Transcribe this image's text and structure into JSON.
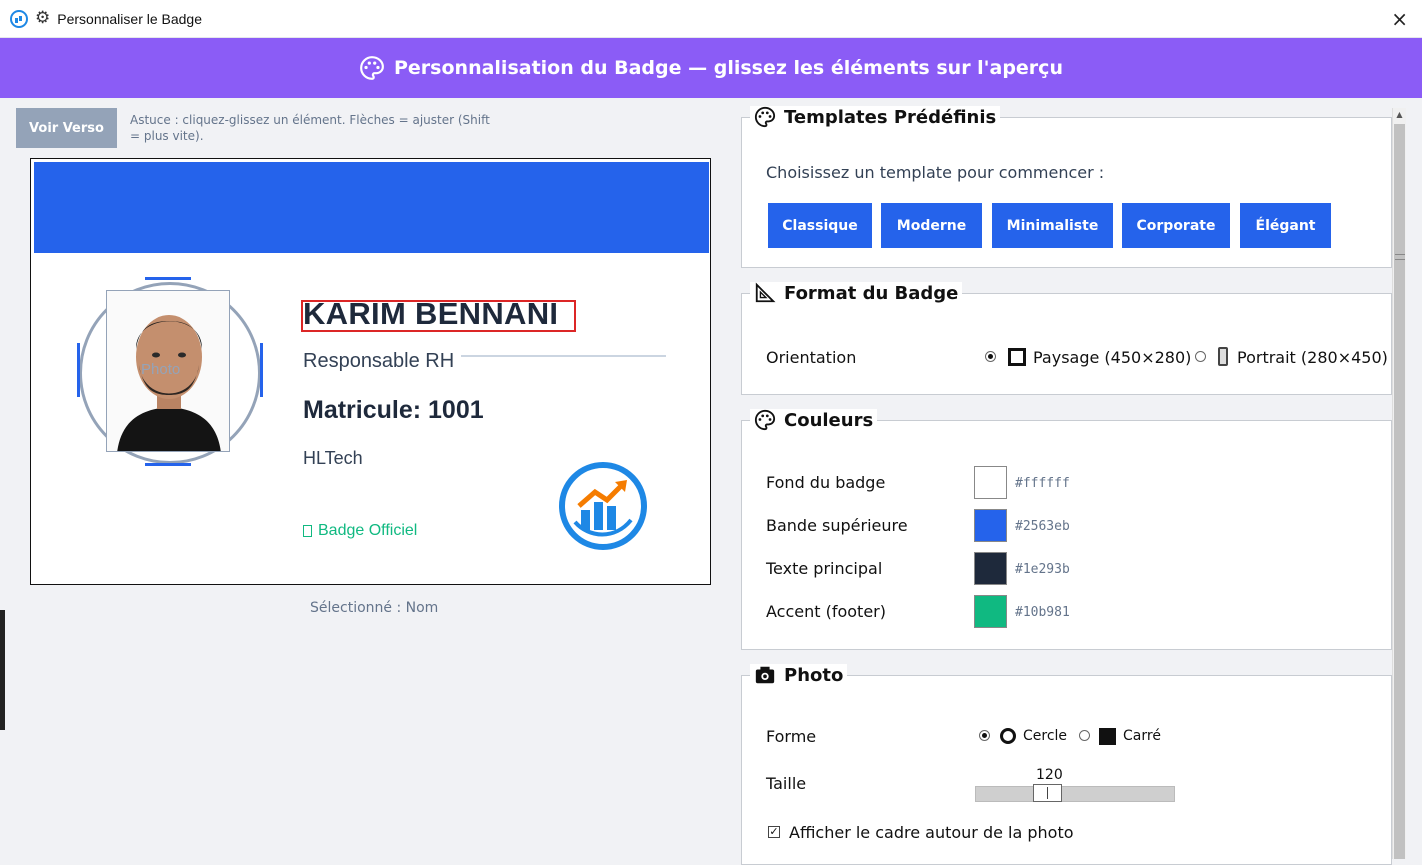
{
  "window": {
    "title": "Personnaliser le Badge",
    "close_icon": "×"
  },
  "header": {
    "title": "Personnalisation du Badge — glissez les éléments sur l'aperçu"
  },
  "left": {
    "verso_button": "Voir Verso",
    "tip": "Astuce : cliquez-glissez un élément. Flèches = ajuster (Shift = plus vite).",
    "selected_text": "Sélectionné : Nom"
  },
  "badge": {
    "photo_label": "Photo",
    "name": "KARIM BENNANI",
    "role": "Responsable RH",
    "matricule": "Matricule: 1001",
    "company": "HLTech",
    "footer": "Badge Officiel"
  },
  "templates": {
    "title": "Templates Prédéfinis",
    "lead": "Choisissez un template pour commencer :",
    "buttons": [
      "Classique",
      "Moderne",
      "Minimaliste",
      "Corporate",
      "Élégant"
    ]
  },
  "format": {
    "title": "Format du Badge",
    "orientation_label": "Orientation",
    "landscape": "Paysage (450×280)",
    "portrait": "Portrait (280×450)",
    "selected": "landscape"
  },
  "colors": {
    "title": "Couleurs",
    "rows": [
      {
        "label": "Fond du badge",
        "hex": "#ffffff"
      },
      {
        "label": "Bande supérieure",
        "hex": "#2563eb"
      },
      {
        "label": "Texte principal",
        "hex": "#1e293b"
      },
      {
        "label": "Accent (footer)",
        "hex": "#10b981"
      }
    ]
  },
  "photo": {
    "title": "Photo",
    "shape_label": "Forme",
    "circle": "Cercle",
    "square": "Carré",
    "selected_shape": "circle",
    "size_label": "Taille",
    "size_value": "120",
    "show_frame_label": "Afficher le cadre autour de la photo",
    "show_frame": true
  }
}
